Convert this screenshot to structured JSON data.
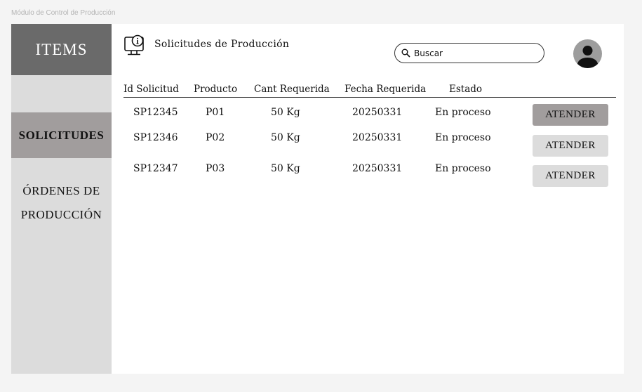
{
  "frame_label": "Módulo de Control de Producción",
  "sidebar": {
    "title": "ITEMS",
    "items": [
      {
        "label": "SOLICITUDES",
        "active": true
      },
      {
        "label": "ÓRDENES DE PRODUCCIÓN",
        "active": false
      }
    ]
  },
  "header": {
    "title": "Solicitudes de Producción",
    "icon": "info-monitor-icon",
    "search_placeholder": "Buscar"
  },
  "table": {
    "columns": [
      "Id Solicitud",
      "Producto",
      "Cant Requerida",
      "Fecha Requerida",
      "Estado"
    ],
    "rows": [
      {
        "id": "SP12345",
        "producto": "P01",
        "cantidad": "50 Kg",
        "fecha": "20250331",
        "estado": "En proceso",
        "action": "ATENDER"
      },
      {
        "id": "SP12346",
        "producto": "P02",
        "cantidad": "50 Kg",
        "fecha": "20250331",
        "estado": "En proceso",
        "action": "ATENDER"
      },
      {
        "id": "SP12347",
        "producto": "P03",
        "cantidad": "50 Kg",
        "fecha": "20250331",
        "estado": "En proceso",
        "action": "ATENDER"
      }
    ]
  },
  "colors": {
    "sidebar_title_bg": "#6a6a6a",
    "sidebar_bg": "#dcdcdc",
    "active_bg": "#a19d9d",
    "button_bg": "#dcdcdc"
  }
}
